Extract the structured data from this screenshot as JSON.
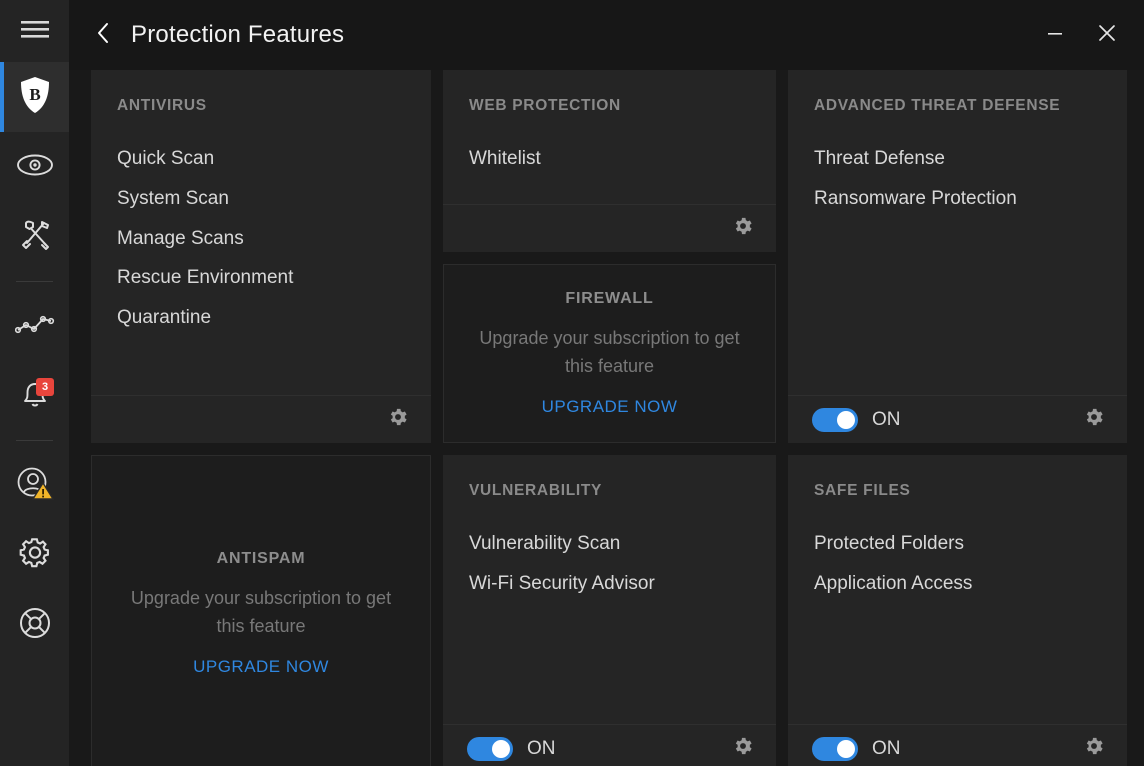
{
  "window": {
    "title": "Protection Features",
    "back_icon": "chevron-left-icon",
    "minimize_label": "Minimize",
    "minimize_icon": "minimize-icon",
    "close_label": "Close",
    "close_icon": "close-icon"
  },
  "colors": {
    "accent": "#2f87e0",
    "page_bg": "#191919",
    "card_bg": "#252525",
    "sidebar_bg": "#242424",
    "badge_red": "#e8453c",
    "warning_yellow": "#f0b429"
  },
  "sidebar": {
    "items": [
      {
        "name": "menu-button",
        "icon": "hamburger-icon",
        "label": "Menu"
      },
      {
        "name": "sidebar-item-protection",
        "icon": "bitdefender-shield-icon",
        "label": "Protection",
        "active": true
      },
      {
        "name": "sidebar-item-privacy",
        "icon": "eye-icon",
        "label": "Privacy"
      },
      {
        "name": "sidebar-item-utilities",
        "icon": "tools-icon",
        "label": "Utilities"
      },
      {
        "name": "sidebar-item-activity",
        "icon": "activity-chart-icon",
        "label": "Activity"
      },
      {
        "name": "sidebar-item-notifications",
        "icon": "bell-icon",
        "label": "Notifications",
        "badge": "3"
      },
      {
        "name": "sidebar-item-account",
        "icon": "account-warning-icon",
        "label": "Account"
      },
      {
        "name": "sidebar-item-settings",
        "icon": "gear-icon",
        "label": "Settings"
      },
      {
        "name": "sidebar-item-support",
        "icon": "lifebuoy-icon",
        "label": "Support"
      }
    ]
  },
  "cards": {
    "antivirus": {
      "title": "ANTIVIRUS",
      "links": [
        "Quick Scan",
        "System Scan",
        "Manage Scans",
        "Rescue Environment",
        "Quarantine"
      ],
      "settings_icon": "gear-icon"
    },
    "web_protection": {
      "title": "WEB PROTECTION",
      "links": [
        "Whitelist"
      ],
      "settings_icon": "gear-icon"
    },
    "firewall": {
      "title": "FIREWALL",
      "message": "Upgrade your subscription to get this feature",
      "cta": "UPGRADE NOW"
    },
    "advanced_threat_defense": {
      "title": "ADVANCED THREAT DEFENSE",
      "links": [
        "Threat Defense",
        "Ransomware Protection"
      ],
      "toggle_state": "ON",
      "settings_icon": "gear-icon"
    },
    "antispam": {
      "title": "ANTISPAM",
      "message": "Upgrade your subscription to get this feature",
      "cta": "UPGRADE NOW"
    },
    "vulnerability": {
      "title": "VULNERABILITY",
      "links": [
        "Vulnerability Scan",
        "Wi-Fi Security Advisor"
      ],
      "toggle_state": "ON",
      "settings_icon": "gear-icon"
    },
    "safe_files": {
      "title": "SAFE FILES",
      "links": [
        "Protected Folders",
        "Application Access"
      ],
      "toggle_state": "ON",
      "settings_icon": "gear-icon"
    }
  }
}
